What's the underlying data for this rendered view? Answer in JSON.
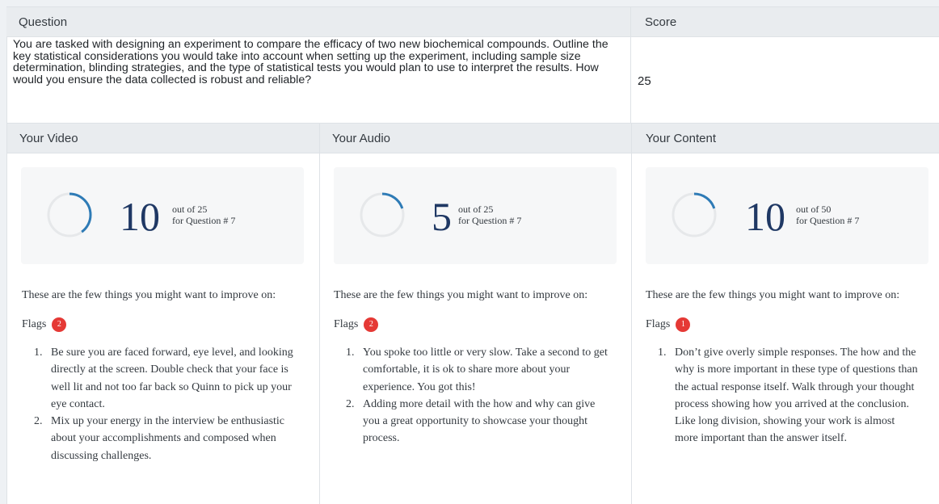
{
  "question_header": "Question",
  "score_header": "Score",
  "question_text": "You are tasked with designing an experiment to compare the efficacy of two new biochemical compounds. Outline the key statistical considerations you would take into account when setting up the experiment, including sample size determination, blinding strategies, and the type of statistical tests you would plan to use to interpret the results. How would you ensure the data collected is robust and reliable?",
  "score_value": "25",
  "colors": {
    "ring_track": "#e6e8ea",
    "ring_arc": "#2e7bb6",
    "badge": "#e53935",
    "number": "#1f3864"
  },
  "sections": [
    {
      "header": "Your Video",
      "score": "10",
      "ring_fraction": 0.4,
      "out_of": "out of 25",
      "for_question": "for Question #  7",
      "intro": "These are the few things you might want to improve on:",
      "flags_label": "Flags",
      "flags_count": "2",
      "items": [
        "Be sure you are faced forward, eye level, and looking directly at the screen. Double check that your face is well lit and not too far back so Quinn to pick up your eye contact.",
        "Mix up your energy in the interview be enthusiastic about your accomplishments and composed when discussing challenges."
      ]
    },
    {
      "header": "Your Audio",
      "score": "5",
      "ring_fraction": 0.2,
      "out_of": "out of 25",
      "for_question": "for Question #  7",
      "intro": "These are the few things you might want to improve on:",
      "flags_label": "Flags",
      "flags_count": "2",
      "items": [
        "You spoke too little or very slow. Take a second to get comfortable, it is ok to share more about your experience. You got this!",
        "Adding more detail with the  how and why  can give you a great opportunity to showcase your thought process."
      ]
    },
    {
      "header": "Your Content",
      "score": "10",
      "ring_fraction": 0.2,
      "out_of": "out of 50",
      "for_question": "for Question #  7",
      "intro": "These are the few things you might want to improve on:",
      "flags_label": "Flags",
      "flags_count": "1",
      "items": [
        "Don’t give overly simple responses. The how and the why is more important in these type of questions than the actual response itself. Walk through your thought process showing how you arrived at the conclusion. Like long division, showing your work is almost more important than the answer itself."
      ]
    }
  ]
}
